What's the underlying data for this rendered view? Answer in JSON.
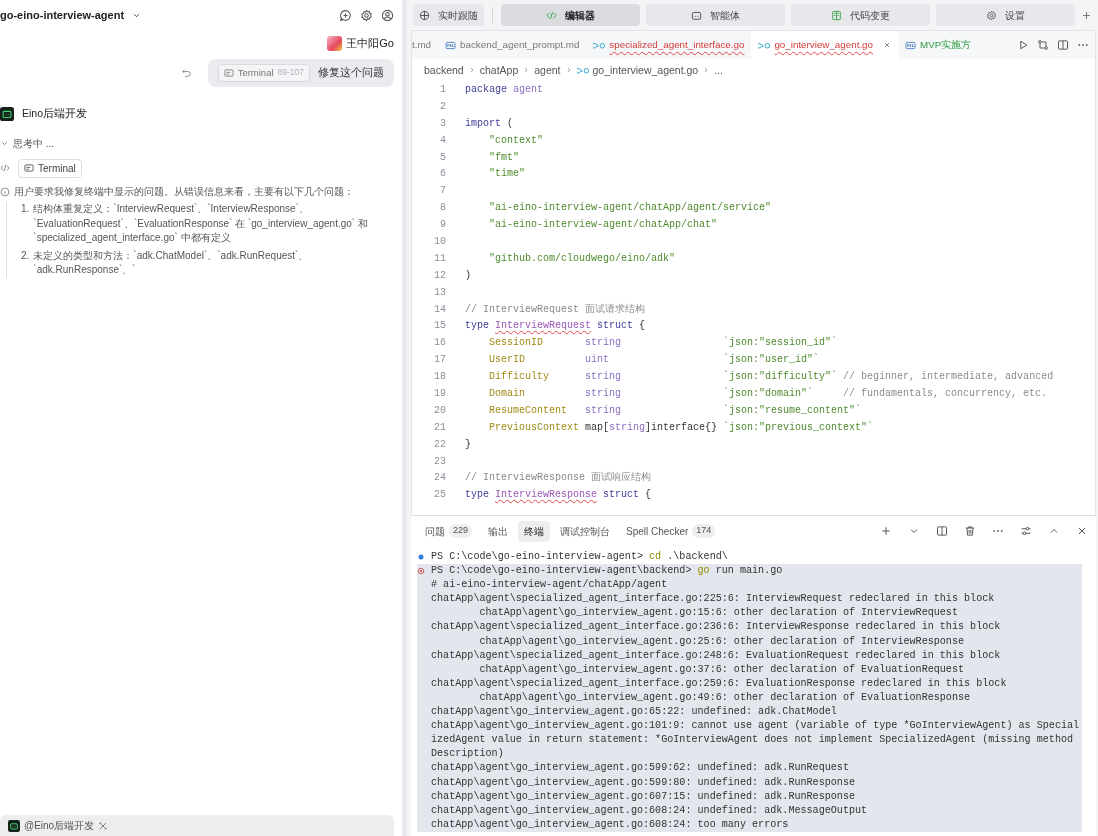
{
  "left_panel": {
    "project": {
      "title": "go-eino-interview-agent"
    },
    "user": {
      "name": "王中阳Go"
    },
    "user_message": {
      "attachment": {
        "label": "Terminal",
        "range": "89-107"
      },
      "text": "修复这个问题"
    },
    "agent": {
      "name": "Eino后端开发"
    },
    "thinking": {
      "label": "思考中 ...",
      "expanded": true
    },
    "tool_chip": {
      "label": "Terminal"
    },
    "reasoning": {
      "intro": "用户要求我修复终端中显示的问题。从错误信息来看，主要有以下几个问题：",
      "items": [
        {
          "number": "1.",
          "text": "结构体重复定义：`InterviewRequest`、`InterviewResponse`、`EvaluationRequest`、`EvaluationResponse` 在 `go_interview_agent.go` 和 `specialized_agent_interface.go` 中都有定义"
        },
        {
          "number": "2.",
          "text": "未定义的类型和方法：`adk.ChatModel`、`adk.RunRequest`、`adk.RunResponse`、`"
        }
      ]
    },
    "input_bar": {
      "mention": "@Eino后端开发"
    }
  },
  "top_tabs": [
    {
      "label": "实时跟随",
      "kind": "follow",
      "selected": false
    },
    {
      "label": "编辑器",
      "kind": "editor",
      "selected": true
    },
    {
      "label": "智能体",
      "kind": "agent",
      "selected": false
    },
    {
      "label": "代码变更",
      "kind": "changes",
      "selected": false
    },
    {
      "label": "设置",
      "kind": "settings",
      "selected": false
    }
  ],
  "editor": {
    "file_tabs": [
      {
        "label": "t.md",
        "kind": "partial",
        "selected": false,
        "error": false,
        "untracked": false
      },
      {
        "label": "backend_agent_prompt.md",
        "kind": "md",
        "selected": false,
        "error": false,
        "untracked": false
      },
      {
        "label": "specialized_agent_interface.go",
        "kind": "go",
        "selected": false,
        "error": true,
        "untracked": false
      },
      {
        "label": "go_interview_agent.go",
        "kind": "go",
        "selected": true,
        "error": true,
        "untracked": false
      },
      {
        "label": "MVP实施方",
        "kind": "md",
        "selected": false,
        "error": false,
        "untracked": true
      }
    ],
    "breadcrumb": [
      {
        "label": "backend",
        "kind": "folder"
      },
      {
        "label": "chatApp",
        "kind": "folder"
      },
      {
        "label": "agent",
        "kind": "folder"
      },
      {
        "label": "go_interview_agent.go",
        "kind": "go"
      },
      {
        "label": "...",
        "kind": "more"
      }
    ],
    "code_lines": [
      {
        "number": "1",
        "tokens": [
          {
            "kind": "keyword",
            "text": "package "
          },
          {
            "kind": "package",
            "text": "agent"
          }
        ]
      },
      {
        "number": "2"
      },
      {
        "number": "3",
        "tokens": [
          {
            "kind": "keyword",
            "text": "import"
          },
          {
            "kind": "plain",
            "text": " ("
          }
        ]
      },
      {
        "number": "4",
        "tokens": [
          {
            "kind": "string",
            "text": "    \"context\""
          }
        ]
      },
      {
        "number": "5",
        "tokens": [
          {
            "kind": "string",
            "text": "    \"fmt\""
          }
        ]
      },
      {
        "number": "6",
        "tokens": [
          {
            "kind": "string",
            "text": "    \"time\""
          }
        ]
      },
      {
        "number": "7"
      },
      {
        "number": "8",
        "tokens": [
          {
            "kind": "string",
            "text": "    \"ai-eino-interview-agent/chatApp/agent/service\""
          }
        ]
      },
      {
        "number": "9",
        "tokens": [
          {
            "kind": "string",
            "text": "    \"ai-eino-interview-agent/chatApp/chat\""
          }
        ]
      },
      {
        "number": "10"
      },
      {
        "number": "11",
        "tokens": [
          {
            "kind": "string",
            "text": "    \"github.com/cloudwego/eino/adk\""
          }
        ]
      },
      {
        "number": "12",
        "tokens": [
          {
            "kind": "plain",
            "text": ")"
          }
        ]
      },
      {
        "number": "13"
      },
      {
        "number": "14",
        "tokens": [
          {
            "kind": "comment",
            "text": "// InterviewRequest 面试请求结构"
          }
        ]
      },
      {
        "number": "15",
        "tokens": [
          {
            "kind": "keyword",
            "text": "type "
          },
          {
            "kind": "errorname",
            "text": "InterviewRequest"
          },
          {
            "kind": "keyword",
            "text": " struct"
          },
          {
            "kind": "plain",
            "text": " {"
          }
        ]
      },
      {
        "number": "16",
        "tokens": [
          {
            "kind": "field",
            "text": "    SessionID       "
          },
          {
            "kind": "type",
            "text": "string                 "
          },
          {
            "kind": "string",
            "text": "`json:\"session_id\"`"
          }
        ]
      },
      {
        "number": "17",
        "tokens": [
          {
            "kind": "field",
            "text": "    UserID          "
          },
          {
            "kind": "type",
            "text": "uint                   "
          },
          {
            "kind": "string",
            "text": "`json:\"user_id\"`"
          }
        ]
      },
      {
        "number": "18",
        "tokens": [
          {
            "kind": "field",
            "text": "    Difficulty      "
          },
          {
            "kind": "type",
            "text": "string                 "
          },
          {
            "kind": "string",
            "text": "`json:\"difficulty\"`"
          },
          {
            "kind": "comment",
            "text": " // beginner, intermediate, advanced"
          }
        ]
      },
      {
        "number": "19",
        "tokens": [
          {
            "kind": "field",
            "text": "    Domain          "
          },
          {
            "kind": "type",
            "text": "string                 "
          },
          {
            "kind": "string",
            "text": "`json:\"domain\"`"
          },
          {
            "kind": "comment",
            "text": "     // fundamentals, concurrency, etc."
          }
        ]
      },
      {
        "number": "20",
        "tokens": [
          {
            "kind": "field",
            "text": "    ResumeContent   "
          },
          {
            "kind": "type",
            "text": "string                 "
          },
          {
            "kind": "string",
            "text": "`json:\"resume_content\"`"
          }
        ]
      },
      {
        "number": "21",
        "tokens": [
          {
            "kind": "field",
            "text": "    PreviousContext "
          },
          {
            "kind": "plain",
            "text": "map["
          },
          {
            "kind": "type",
            "text": "string"
          },
          {
            "kind": "plain",
            "text": "]interface{} "
          },
          {
            "kind": "string",
            "text": "`json:\"previous_context\"`"
          }
        ]
      },
      {
        "number": "22",
        "tokens": [
          {
            "kind": "plain",
            "text": "}"
          }
        ]
      },
      {
        "number": "23"
      },
      {
        "number": "24",
        "tokens": [
          {
            "kind": "comment",
            "text": "// InterviewResponse 面试响应结构"
          }
        ]
      },
      {
        "number": "25",
        "tokens": [
          {
            "kind": "keyword",
            "text": "type "
          },
          {
            "kind": "errorname",
            "text": "InterviewResponse"
          },
          {
            "kind": "keyword",
            "text": " struct"
          },
          {
            "kind": "plain",
            "text": " {"
          }
        ]
      }
    ]
  },
  "panel": {
    "tabs": [
      {
        "label": "问题",
        "count": "229",
        "selected": false
      },
      {
        "label": "输出",
        "selected": false
      },
      {
        "label": "终端",
        "selected": true
      },
      {
        "label": "调试控制台",
        "selected": false
      },
      {
        "label": "Spell Checker",
        "count": "174",
        "selected": false
      }
    ],
    "terminal_lines": [
      {
        "prompt": "PS C:\\code\\go-eino-interview-agent> ",
        "command": "cd",
        "args": " .\\backend\\",
        "failed": false,
        "highlighted": false
      },
      {
        "prompt": "PS C:\\code\\go-eino-interview-agent\\backend> ",
        "command": "go",
        "args": " run main.go",
        "failed": true,
        "highlighted": true
      },
      {
        "text": "# ai-eino-interview-agent/chatApp/agent",
        "highlighted": true
      },
      {
        "text": "chatApp\\agent\\specialized_agent_interface.go:225:6: InterviewRequest redeclared in this block",
        "highlighted": true
      },
      {
        "text": "        chatApp\\agent\\go_interview_agent.go:15:6: other declaration of InterviewRequest",
        "highlighted": true
      },
      {
        "text": "chatApp\\agent\\specialized_agent_interface.go:236:6: InterviewResponse redeclared in this block",
        "highlighted": true
      },
      {
        "text": "        chatApp\\agent\\go_interview_agent.go:25:6: other declaration of InterviewResponse",
        "highlighted": true
      },
      {
        "text": "chatApp\\agent\\specialized_agent_interface.go:248:6: EvaluationRequest redeclared in this block",
        "highlighted": true
      },
      {
        "text": "        chatApp\\agent\\go_interview_agent.go:37:6: other declaration of EvaluationRequest",
        "highlighted": true
      },
      {
        "text": "chatApp\\agent\\specialized_agent_interface.go:259:6: EvaluationResponse redeclared in this block",
        "highlighted": true
      },
      {
        "text": "        chatApp\\agent\\go_interview_agent.go:49:6: other declaration of EvaluationResponse",
        "highlighted": true
      },
      {
        "text": "chatApp\\agent\\go_interview_agent.go:65:22: undefined: adk.ChatModel",
        "highlighted": true
      },
      {
        "text": "chatApp\\agent\\go_interview_agent.go:101:9: cannot use agent (variable of type *GoInterviewAgent) as Special",
        "highlighted": true
      },
      {
        "text": "izedAgent value in return statement: *GoInterviewAgent does not implement SpecializedAgent (missing method",
        "highlighted": true
      },
      {
        "text": "Description)",
        "highlighted": true
      },
      {
        "text": "chatApp\\agent\\go_interview_agent.go:599:62: undefined: adk.RunRequest",
        "highlighted": true
      },
      {
        "text": "chatApp\\agent\\go_interview_agent.go:599:80: undefined: adk.RunResponse",
        "highlighted": true
      },
      {
        "text": "chatApp\\agent\\go_interview_agent.go:607:15: undefined: adk.RunResponse",
        "highlighted": true
      },
      {
        "text": "chatApp\\agent\\go_interview_agent.go:608:24: undefined: adk.MessageOutput",
        "highlighted": true
      },
      {
        "text": "chatApp\\agent\\go_interview_agent.go:608:24: too many errors",
        "highlighted": true
      }
    ]
  }
}
